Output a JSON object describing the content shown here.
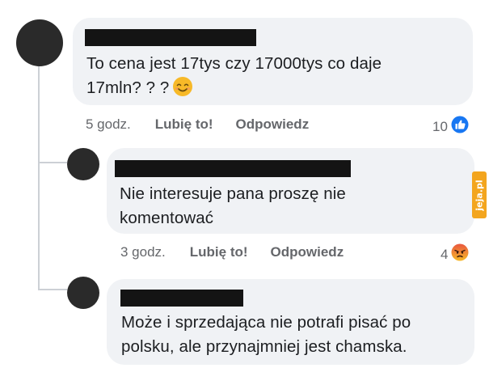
{
  "comments": [
    {
      "text": "To cena jest 17tys czy 17000tys co daje\n17mln? ? ?",
      "emoji_icon": "smiling-face-emoji",
      "time": "5 godz.",
      "like_label": "Lubię to!",
      "reply_label": "Odpowiedz",
      "reaction_count": "10",
      "reaction_icon": "like-thumb-icon"
    },
    {
      "text": "Nie interesuje pana proszę nie\nkomentować",
      "time": "3 godz.",
      "like_label": "Lubię to!",
      "reply_label": "Odpowiedz",
      "reaction_count": "4",
      "reaction_icon": "angry-reaction-icon"
    },
    {
      "text": "Może i sprzedająca nie potrafi pisać po\npolsku, ale przynajmniej jest chamska."
    }
  ],
  "watermark": {
    "text": "jeja.pl",
    "color": "#f3a51e"
  },
  "colors": {
    "bubble": "#f0f2f5",
    "meta_text": "#65676b",
    "like_blue": "#1877f2",
    "angry_orange": "#f5823a"
  }
}
